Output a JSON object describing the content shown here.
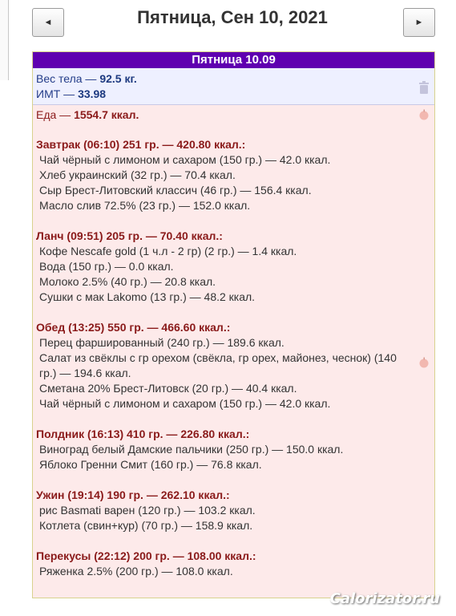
{
  "nav": {
    "prev_label": "◄",
    "next_label": "►",
    "date_title": "Пятница, Сен 10, 2021"
  },
  "day": {
    "header": "Пятница 10.09",
    "weight_label": "Вес тела — ",
    "weight_value": "92.5 кг.",
    "bmi_label": "ИМТ — ",
    "bmi_value": "33.98",
    "food_label": "Еда — ",
    "food_value": "1554.7 ккал."
  },
  "meals": [
    {
      "title": "Завтрак (06:10) 251 гр. — 420.80 ккал.:",
      "items": [
        "Чай чёрный с лимоном и сахаром (150 гр.) — 42.0 ккал.",
        "Хлеб украинский (32 гр.) — 70.4 ккал.",
        "Сыр Брест-Литовский классич (46 гр.) — 156.4 ккал.",
        "Масло слив 72.5% (23 гр.) — 152.0 ккал."
      ]
    },
    {
      "title": "Ланч (09:51) 205 гр. — 70.40 ккал.:",
      "items": [
        "Кофе Nescafe gold (1 ч.л - 2 гр) (2 гр.) — 1.4 ккал.",
        "Вода (150 гр.) — 0.0 ккал.",
        "Молоко 2.5% (40 гр.) — 20.8 ккал.",
        "Сушки с мак Lakomo (13 гр.) — 48.2 ккал."
      ]
    },
    {
      "title": "Обед (13:25) 550 гр. — 466.60 ккал.:",
      "items": [
        "Перец фаршированный (240 гр.) — 189.6 ккал.",
        "Салат из свёклы с гр орехом (свёкла, гр орех, майонез, чеснок) (140 гр.) — 194.6 ккал.",
        "Сметана 20% Брест-Литовск (20 гр.) — 40.4 ккал.",
        "Чай чёрный с лимоном и сахаром (150 гр.) — 42.0 ккал."
      ]
    },
    {
      "title": "Полдник (16:13) 410 гр. — 226.80 ккал.:",
      "items": [
        "Виноград белый Дамские пальчики (250 гр.) — 150.0 ккал.",
        "Яблоко Гренни Смит (160 гр.) — 76.8 ккал."
      ]
    },
    {
      "title": "Ужин (19:14) 190 гр. — 262.10 ккал.:",
      "items": [
        "рис Basmati варен (120 гр.) — 103.2 ккал.",
        "Котлета (свин+кур) (70 гр.) — 158.9 ккал."
      ]
    },
    {
      "title": "Перекусы (22:12) 200 гр. — 108.00 ккал.:",
      "items": [
        "Ряженка 2.5% (200 гр.) — 108.0 ккал."
      ]
    }
  ],
  "watermark": "Calorizator.ru",
  "icons": {
    "trash": "trash-icon",
    "apple": "apple-icon"
  }
}
